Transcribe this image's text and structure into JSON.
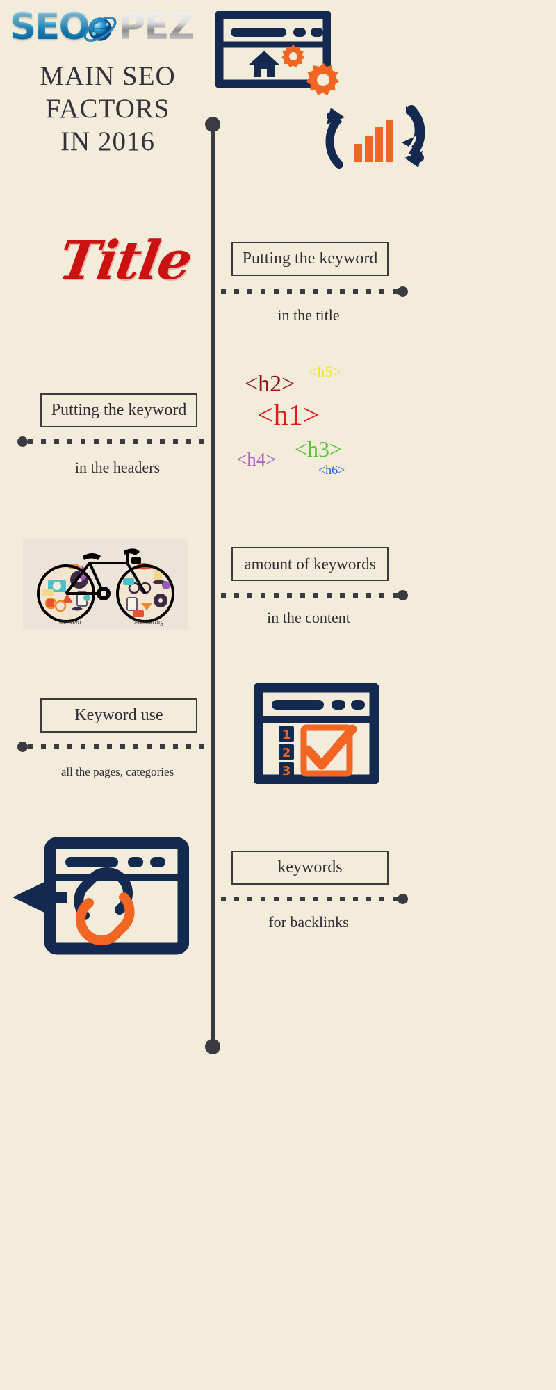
{
  "brand": {
    "logo_seo": "SEO",
    "logo_pez": "PEZ",
    "logo_icon": "globe-icon"
  },
  "header": {
    "title_line1": "MAIN SEO",
    "title_line2": "FACTORS",
    "title_line3": "IN 2016",
    "icon_browser": "browser-home-icon",
    "icon_gears": "gears-icon",
    "icon_refresh_chart": "refresh-bar-chart-icon"
  },
  "colors": {
    "background": "#f3ecdb",
    "navy": "#14294f",
    "orange": "#f26522",
    "dark": "#3a3a40",
    "red": "#cc1111"
  },
  "sections": [
    {
      "id": "title",
      "left_visual": "Title",
      "box_label": "Putting the keyword",
      "caption": "in the title"
    },
    {
      "id": "headers",
      "box_label": "Putting the keyword",
      "caption": "in the headers",
      "tags": [
        {
          "text": "<h1>",
          "color": "#e01b1b"
        },
        {
          "text": "<h2>",
          "color": "#8f1717"
        },
        {
          "text": "<h3>",
          "color": "#5bc236"
        },
        {
          "text": "<h4>",
          "color": "#ad5fc4"
        },
        {
          "text": "<h5>",
          "color": "#f2e32a"
        },
        {
          "text": "<h6>",
          "color": "#2b5fd4"
        }
      ]
    },
    {
      "id": "content",
      "box_label": "amount of keywords",
      "caption": "in the content",
      "image_alt": "content-marketing-bicycle-image",
      "image_label_left": "Content",
      "image_label_right": "Marketing"
    },
    {
      "id": "pages",
      "box_label": "Keyword use",
      "caption": "all the pages, categories",
      "icon": "browser-checklist-icon",
      "list_numbers": [
        "1",
        "2",
        "3"
      ]
    },
    {
      "id": "backlinks",
      "box_label": "keywords",
      "caption": "for backlinks",
      "icon": "browser-link-arrow-icon"
    }
  ]
}
